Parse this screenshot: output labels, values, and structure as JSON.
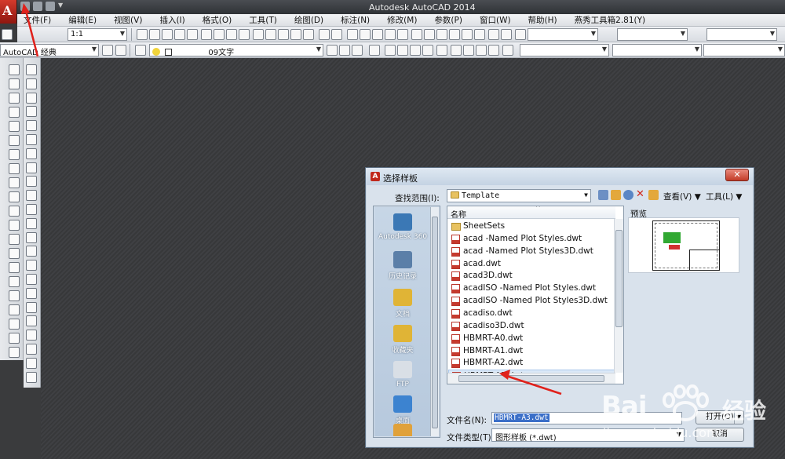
{
  "app": {
    "title": "Autodesk AutoCAD 2014",
    "logo_letter": "A"
  },
  "menu": [
    "文件(F)",
    "编辑(E)",
    "视图(V)",
    "插入(I)",
    "格式(O)",
    "工具(T)",
    "绘图(D)",
    "标注(N)",
    "修改(M)",
    "参数(P)",
    "窗口(W)",
    "帮助(H)",
    "燕秀工具箱2.81(Y)"
  ],
  "toolbar": {
    "scale_combo": "1:1",
    "workspace_combo": "AutoCAD 经典",
    "layer_combo": "09文字"
  },
  "dialog": {
    "title": "选择样板",
    "close_label": "✕",
    "lookin_label": "查找范围(I):",
    "lookin_value": "Template",
    "views_label": "查看(V)",
    "tools_label": "工具(L)",
    "places": [
      "Autodesk 360",
      "历史记录",
      "文档",
      "收藏夹",
      "FTP",
      "桌面"
    ],
    "list_header": "名称",
    "files": [
      {
        "name": "SheetSets",
        "type": "folder"
      },
      {
        "name": "acad -Named Plot Styles.dwt",
        "type": "dwt"
      },
      {
        "name": "acad -Named Plot Styles3D.dwt",
        "type": "dwt"
      },
      {
        "name": "acad.dwt",
        "type": "dwt"
      },
      {
        "name": "acad3D.dwt",
        "type": "dwt"
      },
      {
        "name": "acadISO -Named Plot Styles.dwt",
        "type": "dwt"
      },
      {
        "name": "acadISO -Named Plot Styles3D.dwt",
        "type": "dwt"
      },
      {
        "name": "acadiso.dwt",
        "type": "dwt"
      },
      {
        "name": "acadiso3D.dwt",
        "type": "dwt"
      },
      {
        "name": "HBMRT-A0.dwt",
        "type": "dwt"
      },
      {
        "name": "HBMRT-A1.dwt",
        "type": "dwt"
      },
      {
        "name": "HBMRT-A2.dwt",
        "type": "dwt"
      },
      {
        "name": "HBMRT-A3.dwt",
        "type": "dwt",
        "selected": true
      }
    ],
    "preview_label": "预览",
    "filename_label": "文件名(N):",
    "filename_value": "HBMRT-A3.dwt",
    "filetype_label": "文件类型(T):",
    "filetype_value": "图形样板 (*.dwt)",
    "open_button": "打开(O)",
    "cancel_button": "取消"
  },
  "watermark": {
    "brand": "Bai",
    "brand_cn": "经验",
    "url": "jingyan.baidu.com"
  },
  "colors": {
    "annotation": "#e0211b",
    "selection": "#3b6fc8"
  }
}
